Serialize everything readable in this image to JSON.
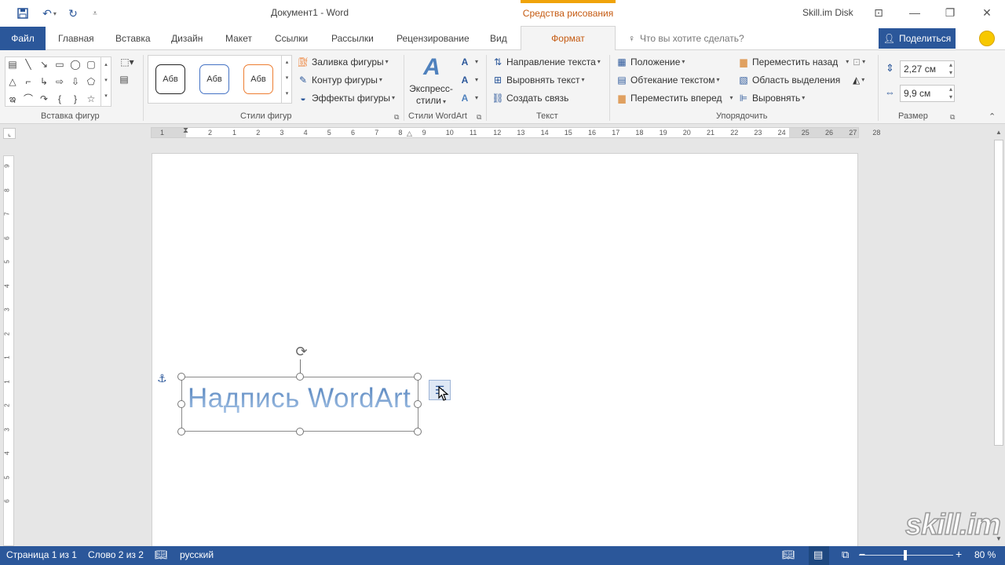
{
  "titlebar": {
    "doc_title": "Документ1  -  Word",
    "context_tab": "Средства рисования",
    "account": "Skill.im Disk",
    "qat_icons": [
      "save-icon",
      "undo-icon",
      "redo-icon",
      "customize-icon"
    ]
  },
  "tabs": {
    "file": "Файл",
    "items": [
      "Главная",
      "Вставка",
      "Дизайн",
      "Макет",
      "Ссылки",
      "Рассылки",
      "Рецензирование",
      "Вид"
    ],
    "format": "Формат",
    "tellme": "Что вы хотите сделать?",
    "share": "Поделиться"
  },
  "ribbon": {
    "insert_shapes_label": "Вставка фигур",
    "shape_styles_label": "Стили фигур",
    "style_box_text": "Абв",
    "fill": "Заливка фигуры",
    "outline": "Контур фигуры",
    "effects": "Эффекты фигуры",
    "wordart_label": "Стили WordArt",
    "express_styles_line1": "Экспресс-",
    "express_styles_line2": "стили",
    "text_label": "Текст",
    "text_direction": "Направление текста",
    "align_text": "Выровнять текст",
    "create_link": "Создать связь",
    "arrange_label": "Упорядочить",
    "position": "Положение",
    "wrap_text": "Обтекание текстом",
    "bring_forward": "Переместить вперед",
    "send_backward": "Переместить назад",
    "selection_pane": "Область выделения",
    "align": "Выровнять",
    "size_label": "Размер",
    "height": "2,27 см",
    "width": "9,9 см"
  },
  "ruler": {
    "h_ticks": [
      "1",
      "2",
      "1",
      "2",
      "3",
      "4",
      "5",
      "6",
      "7",
      "8",
      "9",
      "10",
      "11",
      "12",
      "13",
      "14",
      "15",
      "16",
      "17",
      "18",
      "19",
      "20",
      "21",
      "22",
      "23",
      "24",
      "25",
      "26",
      "27",
      "28"
    ],
    "v_ticks": [
      "9",
      "8",
      "7",
      "6",
      "5",
      "4",
      "3",
      "2",
      "1",
      "1",
      "2",
      "3",
      "4",
      "5",
      "6"
    ]
  },
  "document": {
    "wordart_text": "Надпись WordArt"
  },
  "watermark": "skill.im",
  "status": {
    "page": "Страница 1 из 1",
    "words": "Слово 2 из 2",
    "language": "русский",
    "zoom": "80 %"
  }
}
